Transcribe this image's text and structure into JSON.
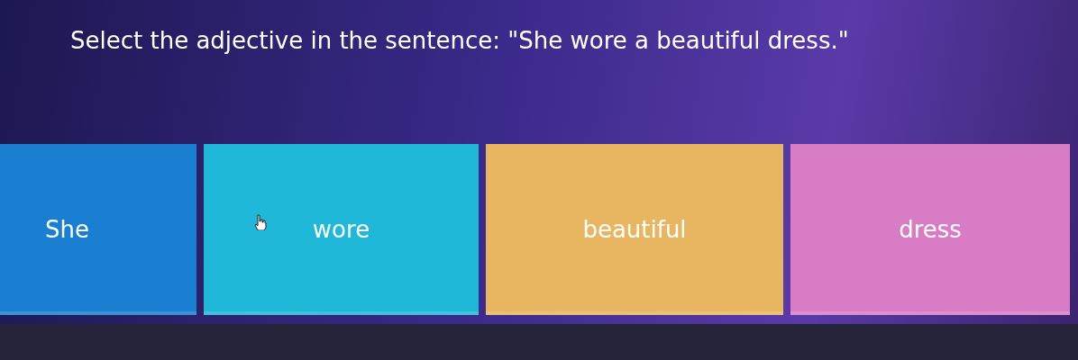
{
  "question": "Select the adjective in the sentence: \"She wore a beautiful dress.\"",
  "options": [
    {
      "label": "She",
      "color": "#1a7fd0"
    },
    {
      "label": "wore",
      "color": "#1fb8d8"
    },
    {
      "label": "beautiful",
      "color": "#e8b660"
    },
    {
      "label": "dress",
      "color": "#d97cc6"
    }
  ]
}
